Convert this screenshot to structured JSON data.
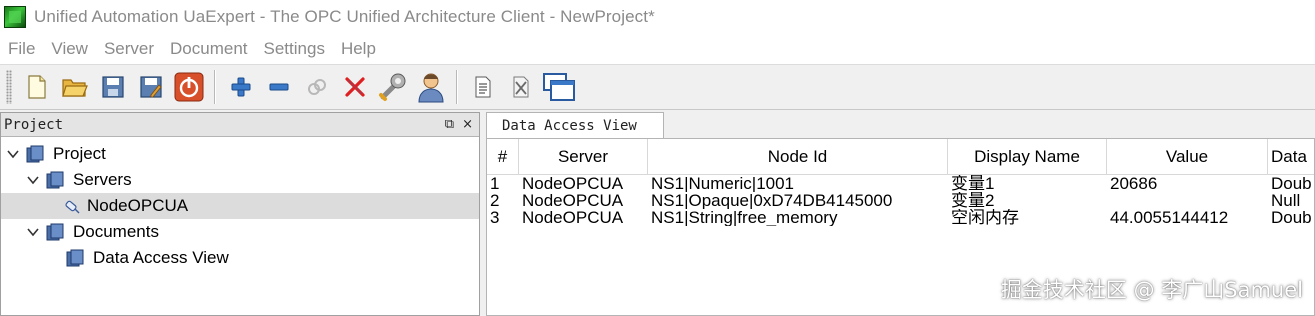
{
  "window": {
    "title": "Unified Automation UaExpert - The OPC Unified Architecture Client - NewProject*"
  },
  "menu": [
    "File",
    "View",
    "Server",
    "Document",
    "Settings",
    "Help"
  ],
  "toolbar": {
    "icons": [
      "new-document-icon",
      "open-folder-icon",
      "save-icon",
      "save-as-icon",
      "power-icon",
      "add-server-icon",
      "remove-server-icon",
      "connect-icon",
      "disconnect-icon",
      "settings-wrench-icon",
      "user-icon",
      "document-icon",
      "clear-icon",
      "windows-icon"
    ]
  },
  "project_panel": {
    "title": "Project",
    "float_glyph": "⧉",
    "close_glyph": "×",
    "tree": [
      {
        "label": "Project",
        "level": 0,
        "expanded": true
      },
      {
        "label": "Servers",
        "level": 1,
        "expanded": true
      },
      {
        "label": "NodeOPCUA",
        "level": 2,
        "selected": true
      },
      {
        "label": "Documents",
        "level": 1,
        "expanded": true
      },
      {
        "label": "Data Access View",
        "level": 2
      }
    ]
  },
  "dock": {
    "tab_label": "Data Access View",
    "table": {
      "columns": [
        "#",
        "Server",
        "Node Id",
        "Display Name",
        "Value",
        "Data"
      ],
      "rows": [
        [
          "1",
          "NodeOPCUA",
          "NS1|Numeric|1001",
          "变量1",
          "20686",
          "Doub"
        ],
        [
          "2",
          "NodeOPCUA",
          "NS1|Opaque|0xD74DB4145000",
          "变量2",
          "",
          "Null"
        ],
        [
          "3",
          "NodeOPCUA",
          "NS1|String|free_memory",
          "空闲内存",
          "44.0055144412",
          "Doub"
        ]
      ]
    }
  },
  "watermark": "掘金技术社区 @ 李广山Samuel"
}
